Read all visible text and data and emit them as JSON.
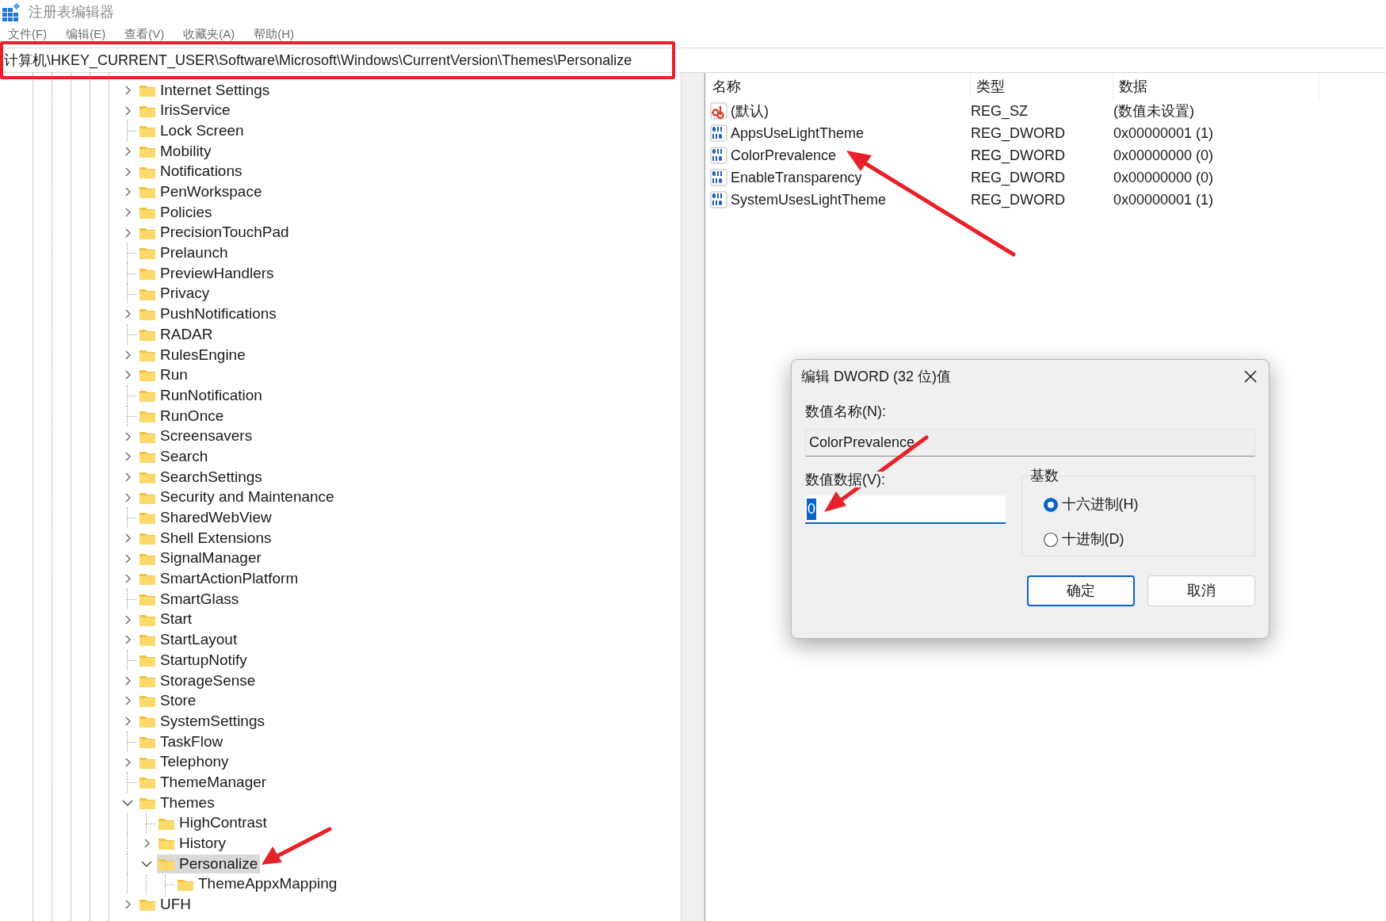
{
  "window": {
    "title": "注册表编辑器"
  },
  "menu": [
    "文件(F)",
    "编辑(E)",
    "查看(V)",
    "收藏夹(A)",
    "帮助(H)"
  ],
  "address_bar": {
    "path": "计算机\\HKEY_CURRENT_USER\\Software\\Microsoft\\Windows\\CurrentVersion\\Themes\\Personalize"
  },
  "tree": {
    "items": [
      {
        "label": "Internet Settings",
        "expanded": false,
        "selected": false
      },
      {
        "label": "IrisService",
        "expanded": false,
        "selected": false
      },
      {
        "label": "Lock Screen",
        "selected": false
      },
      {
        "label": "Mobility",
        "expanded": false,
        "selected": false
      },
      {
        "label": "Notifications",
        "expanded": false,
        "selected": false
      },
      {
        "label": "PenWorkspace",
        "expanded": false,
        "selected": false
      },
      {
        "label": "Policies",
        "expanded": false,
        "selected": false
      },
      {
        "label": "PrecisionTouchPad",
        "expanded": false,
        "selected": false
      },
      {
        "label": "Prelaunch",
        "selected": false
      },
      {
        "label": "PreviewHandlers",
        "selected": false
      },
      {
        "label": "Privacy",
        "selected": false
      },
      {
        "label": "PushNotifications",
        "expanded": false,
        "selected": false
      },
      {
        "label": "RADAR",
        "selected": false
      },
      {
        "label": "RulesEngine",
        "expanded": false,
        "selected": false
      },
      {
        "label": "Run",
        "expanded": false,
        "selected": false
      },
      {
        "label": "RunNotification",
        "selected": false
      },
      {
        "label": "RunOnce",
        "selected": false
      },
      {
        "label": "Screensavers",
        "expanded": false,
        "selected": false
      },
      {
        "label": "Search",
        "expanded": false,
        "selected": false
      },
      {
        "label": "SearchSettings",
        "expanded": false,
        "selected": false
      },
      {
        "label": "Security and Maintenance",
        "expanded": false,
        "selected": false
      },
      {
        "label": "SharedWebView",
        "selected": false
      },
      {
        "label": "Shell Extensions",
        "expanded": false,
        "selected": false
      },
      {
        "label": "SignalManager",
        "expanded": false,
        "selected": false
      },
      {
        "label": "SmartActionPlatform",
        "expanded": false,
        "selected": false
      },
      {
        "label": "SmartGlass",
        "selected": false
      },
      {
        "label": "Start",
        "expanded": false,
        "selected": false
      },
      {
        "label": "StartLayout",
        "expanded": false,
        "selected": false
      },
      {
        "label": "StartupNotify",
        "selected": false
      },
      {
        "label": "StorageSense",
        "expanded": false,
        "selected": false
      },
      {
        "label": "Store",
        "expanded": false,
        "selected": false
      },
      {
        "label": "SystemSettings",
        "expanded": false,
        "selected": false
      },
      {
        "label": "TaskFlow",
        "selected": false
      },
      {
        "label": "Telephony",
        "expanded": false,
        "selected": false
      },
      {
        "label": "ThemeManager",
        "selected": false
      },
      {
        "label": "Themes",
        "expanded": true,
        "selected": false,
        "children": [
          {
            "label": "HighContrast",
            "selected": false
          },
          {
            "label": "History",
            "expanded": false,
            "selected": false
          },
          {
            "label": "Personalize",
            "expanded": true,
            "selected": true,
            "children": [
              {
                "label": "ThemeAppxMapping",
                "selected": false
              }
            ]
          }
        ]
      },
      {
        "label": "UFH",
        "expanded": false,
        "selected": false
      }
    ]
  },
  "values_list": {
    "columns": [
      "名称",
      "类型",
      "数据"
    ],
    "rows": [
      {
        "kind": "string",
        "name": "(默认)",
        "type": "REG_SZ",
        "data": "(数值未设置)"
      },
      {
        "kind": "dword",
        "name": "AppsUseLightTheme",
        "type": "REG_DWORD",
        "data": "0x00000001 (1)"
      },
      {
        "kind": "dword",
        "name": "ColorPrevalence",
        "type": "REG_DWORD",
        "data": "0x00000000 (0)"
      },
      {
        "kind": "dword",
        "name": "EnableTransparency",
        "type": "REG_DWORD",
        "data": "0x00000000 (0)"
      },
      {
        "kind": "dword",
        "name": "SystemUsesLightTheme",
        "type": "REG_DWORD",
        "data": "0x00000001 (1)"
      }
    ]
  },
  "dialog": {
    "title": "编辑 DWORD (32 位)值",
    "name_label": "数值名称(N):",
    "name_value": "ColorPrevalence",
    "data_label": "数值数据(V):",
    "data_value": "0",
    "base": {
      "label": "基数",
      "options": [
        {
          "label": "十六进制(H)",
          "selected": true
        },
        {
          "label": "十进制(D)",
          "selected": false
        }
      ]
    },
    "buttons": [
      {
        "label": "确定",
        "default": true
      },
      {
        "label": "取消",
        "default": false
      }
    ]
  }
}
